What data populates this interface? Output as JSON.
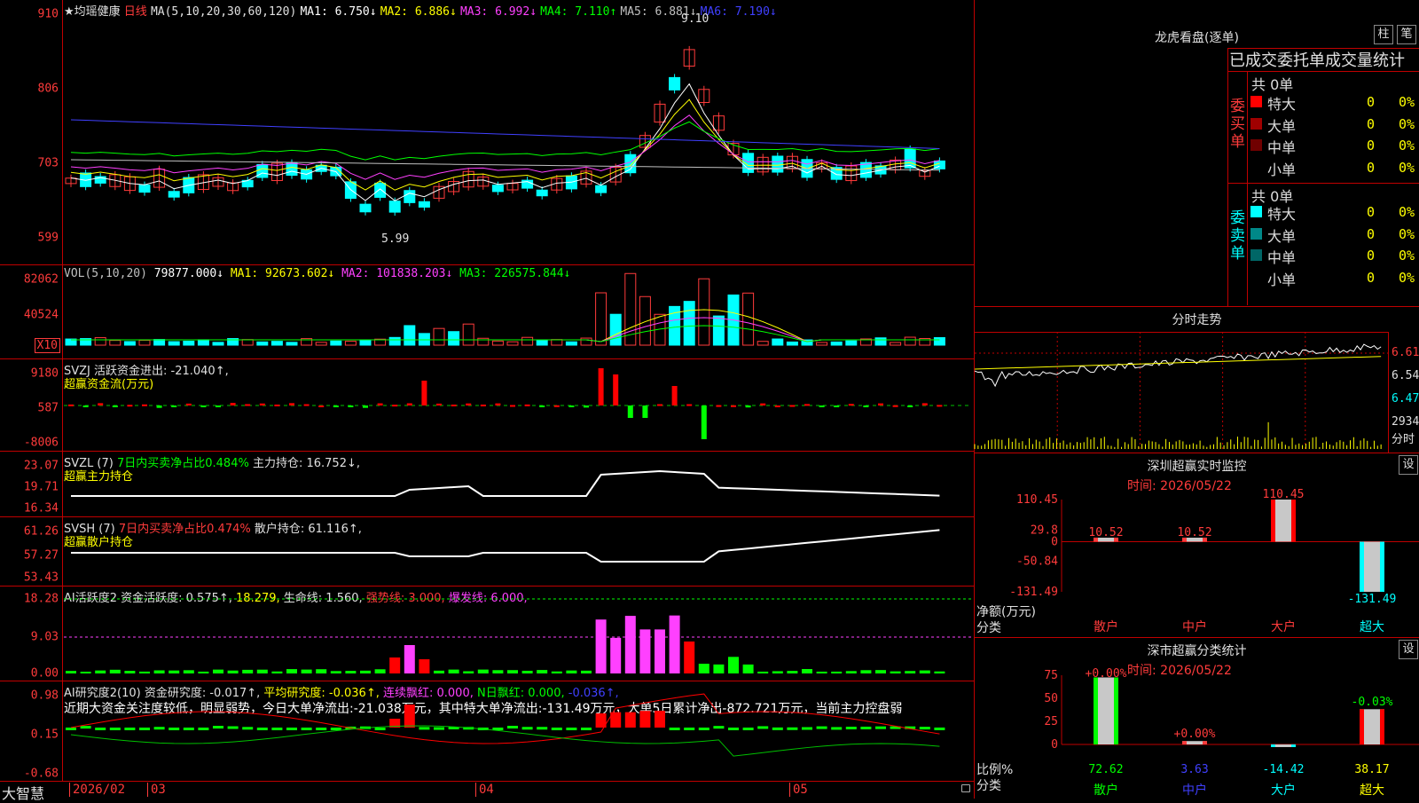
{
  "stock": {
    "name": "★均瑶健康",
    "period": "日线"
  },
  "panels": {
    "kline": {
      "ma_params": "MA(5,10,20,30,60,120)",
      "ma": [
        {
          "label": "MA1: 6.750↓",
          "color": "#ffffff"
        },
        {
          "label": "MA2: 6.886↓",
          "color": "#ffff00"
        },
        {
          "label": "MA3: 6.992↓",
          "color": "#ff40ff"
        },
        {
          "label": "MA4: 7.110↑",
          "color": "#00ff00"
        },
        {
          "label": "MA5: 6.881↓",
          "color": "#c0c0c0"
        },
        {
          "label": "MA6: 7.190↓",
          "color": "#4040ff"
        }
      ],
      "yticks": [
        "910",
        "806",
        "703",
        "599"
      ],
      "high_label": "9.10",
      "low_label": "5.99"
    },
    "vol": {
      "title": "VOL(5,10,20)",
      "value": "79877.000↓",
      "ma": [
        {
          "label": "MA1: 92673.602↓",
          "color": "#ffff00"
        },
        {
          "label": "MA2: 101838.203↓",
          "color": "#ff40ff"
        },
        {
          "label": "MA3: 226575.844↓",
          "color": "#00ff00"
        }
      ],
      "yticks": [
        "82062",
        "40524"
      ],
      "unit": "X10"
    },
    "svzj": {
      "title": "SVZJ  活跃资金进出: -21.040↑,",
      "sub": "超赢资金流(万元)",
      "yticks": [
        "9180",
        "587",
        "-8006"
      ]
    },
    "svzl": {
      "title_a": "SVZL (7)",
      "title_b": "7日内买卖净占比0.484%",
      "title_c": "主力持仓: 16.752↓,",
      "sub": "超赢主力持仓",
      "yticks": [
        "23.07",
        "19.71",
        "16.34"
      ]
    },
    "svsh": {
      "title_a": "SVSH (7)",
      "title_b": "7日内买卖净占比0.474%",
      "title_c": "散户持仓: 61.116↑,",
      "sub": "超赢散户持仓",
      "yticks": [
        "61.26",
        "57.27",
        "53.43"
      ]
    },
    "ai2": {
      "title": "AI活跃度2 资金活跃度: 0.575↑,",
      "v2": "18.279,",
      "v3": "生命线: 1.560,",
      "v4": "强势线: 3.000,",
      "v5": "爆发线: 6.000,",
      "yticks": [
        "18.28",
        "9.03",
        "0.00"
      ]
    },
    "ai_research": {
      "title": "AI研究度2(10) 资金研究度: -0.017↑,",
      "v2": "平均研究度: -0.036↑,",
      "v3": "连续飘红: 0.000,",
      "v4": "N日飘红: 0.000,",
      "v5": "-0.036↑,",
      "note": "近期大资金关注度较低，明显弱势，今日大单净流出:-21.038万元，其中特大单净流出:-131.49万元，大单5日累计净出-872.721万元，当前主力控盘弱",
      "yticks": [
        "0.98",
        "0.15",
        "-0.68"
      ]
    }
  },
  "xaxis": {
    "labels": [
      "2026/02",
      "03",
      "04",
      "05"
    ],
    "brand": "大智慧"
  },
  "dragon": {
    "title": "龙虎看盘(逐单)",
    "btn1": "柱",
    "btn2": "笔",
    "header": "已成交委托单成交量统计",
    "buy": {
      "side": "委买单",
      "total": "共 0单",
      "rows": [
        {
          "label": "特大",
          "count": "0",
          "pct": "0%",
          "color": "#ff0000"
        },
        {
          "label": "大单",
          "count": "0",
          "pct": "0%",
          "color": "#a00000"
        },
        {
          "label": "中单",
          "count": "0",
          "pct": "0%",
          "color": "#700000"
        },
        {
          "label": "小单",
          "count": "0",
          "pct": "0%",
          "color": "#000000"
        }
      ]
    },
    "sell": {
      "side": "委卖单",
      "total": "共 0单",
      "rows": [
        {
          "label": "特大",
          "count": "0",
          "pct": "0%",
          "color": "#00ffff"
        },
        {
          "label": "大单",
          "count": "0",
          "pct": "0%",
          "color": "#008888"
        },
        {
          "label": "中单",
          "count": "0",
          "pct": "0%",
          "color": "#006666"
        },
        {
          "label": "小单",
          "count": "0",
          "pct": "0%",
          "color": "#000000"
        }
      ]
    }
  },
  "intraday": {
    "title": "分时走势",
    "yticks": [
      "6.61",
      "6.54",
      "6.47"
    ],
    "vol_max": "2934",
    "vol_unit": "分时"
  },
  "monitor": {
    "title": "深圳超赢实时监控",
    "btn": "设",
    "time": "时间: 2026/05/22",
    "yticks": [
      "110.45",
      "29.8",
      "0",
      "-50.84",
      "-131.49"
    ],
    "ylabel": "净额(万元)",
    "xlabel": "分类",
    "cats": [
      "散户",
      "中户",
      "大户",
      "超大"
    ],
    "values": [
      10.52,
      10.52,
      110.45,
      -131.49
    ],
    "value_labels": [
      "10.52",
      "10.52",
      "110.45",
      "-131.49"
    ]
  },
  "classify": {
    "title": "深市超赢分类统计",
    "btn": "设",
    "time": "时间: 2026/05/22",
    "yticks": [
      "75",
      "50",
      "25",
      "0"
    ],
    "ylabel": "比例%",
    "xlabel": "分类",
    "cats": [
      "散户",
      "中户",
      "大户",
      "超大"
    ],
    "values": [
      72.62,
      3.63,
      -14.42,
      38.17
    ],
    "value_labels": [
      "72.62",
      "3.63",
      "-14.42",
      "38.17"
    ],
    "top_labels": [
      "+0.00%",
      "+0.00%",
      "-0.03%"
    ]
  },
  "chart_data": [
    {
      "type": "bar",
      "title": "深圳超赢实时监控",
      "ylabel": "净额(万元)",
      "xlabel": "分类",
      "categories": [
        "散户",
        "中户",
        "大户",
        "超大"
      ],
      "values": [
        10.52,
        10.52,
        110.45,
        -131.49
      ],
      "ylim": [
        -131.49,
        110.45
      ]
    },
    {
      "type": "bar",
      "title": "深市超赢分类统计",
      "ylabel": "比例%",
      "xlabel": "分类",
      "categories": [
        "散户",
        "中户",
        "大户",
        "超大"
      ],
      "values": [
        72.62,
        3.63,
        -14.42,
        38.17
      ],
      "ylim": [
        0,
        75
      ]
    }
  ]
}
